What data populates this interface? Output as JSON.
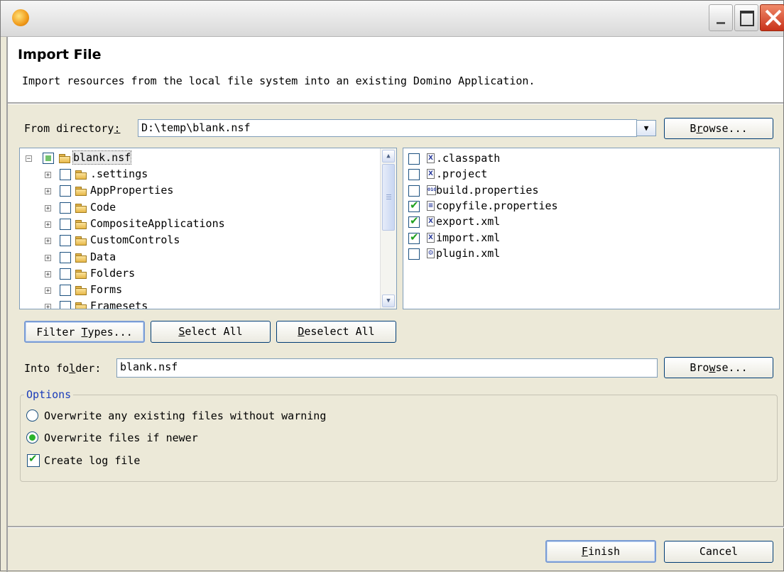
{
  "window": {
    "app_icon": "domino-app-icon"
  },
  "header": {
    "title": "Import File",
    "description": "Import resources from the local file system into an existing Domino Application."
  },
  "from_directory": {
    "label_pre": "From directory",
    "label_suffix": ":",
    "value": "D:\\temp\\blank.nsf",
    "browse": {
      "pre": "B",
      "u": "r",
      "post": "owse..."
    }
  },
  "folder_tree": {
    "root": {
      "label": "blank.nsf",
      "state": "partial",
      "expander": "⊟"
    },
    "items": [
      {
        "label": ".settings",
        "checked": false
      },
      {
        "label": "AppProperties",
        "checked": false
      },
      {
        "label": "Code",
        "checked": false
      },
      {
        "label": "CompositeApplications",
        "checked": false
      },
      {
        "label": "CustomControls",
        "checked": false
      },
      {
        "label": "Data",
        "checked": false
      },
      {
        "label": "Folders",
        "checked": false
      },
      {
        "label": "Forms",
        "checked": false
      },
      {
        "label": "Framesets",
        "checked": false
      }
    ]
  },
  "file_list": {
    "items": [
      {
        "label": ".classpath",
        "checked": false,
        "icon": "xml-file-icon",
        "glyph": "X"
      },
      {
        "label": ".project",
        "checked": false,
        "icon": "xml-file-icon",
        "glyph": "X"
      },
      {
        "label": "build.properties",
        "checked": false,
        "icon": "binary-file-icon",
        "glyph": "010"
      },
      {
        "label": "copyfile.properties",
        "checked": true,
        "icon": "text-file-icon",
        "glyph": "≡"
      },
      {
        "label": "export.xml",
        "checked": true,
        "icon": "xml-file-icon",
        "glyph": "X"
      },
      {
        "label": "import.xml",
        "checked": true,
        "icon": "xml-file-icon",
        "glyph": "X"
      },
      {
        "label": "plugin.xml",
        "checked": false,
        "icon": "plugin-file-icon",
        "glyph": "⚙"
      }
    ]
  },
  "selection_buttons": {
    "filter_types": {
      "pre": "Filter ",
      "u": "T",
      "post": "ypes..."
    },
    "select_all": {
      "pre": "",
      "u": "S",
      "post": "elect All"
    },
    "deselect_all": {
      "pre": "",
      "u": "D",
      "post": "eselect All"
    }
  },
  "into_folder": {
    "label_pre": "Into fo",
    "label_u": "l",
    "label_post": "der:",
    "value": "blank.nsf",
    "browse": {
      "pre": "Bro",
      "u": "w",
      "post": "se..."
    }
  },
  "options": {
    "legend": "Options",
    "overwrite_without_warning": {
      "label": "Overwrite any existing files without warning",
      "selected": false
    },
    "overwrite_if_newer": {
      "label": "Overwrite files if newer",
      "selected": true
    },
    "create_log_file": {
      "label": "Create log file",
      "checked": true
    }
  },
  "footer": {
    "finish": {
      "pre": "",
      "u": "F",
      "post": "inish"
    },
    "cancel": "Cancel"
  }
}
